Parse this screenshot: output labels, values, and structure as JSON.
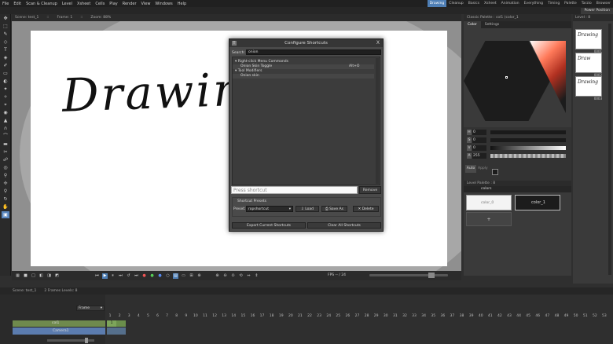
{
  "menubar": {
    "items": [
      "File",
      "Edit",
      "Scan & Cleanup",
      "Level",
      "Xsheet",
      "Cells",
      "Play",
      "Render",
      "View",
      "Windows",
      "Help"
    ]
  },
  "rooms": {
    "items": [
      "Drawing",
      "Cleanup",
      "Basics",
      "Xsheet",
      "Animation",
      "Everything",
      "Timing",
      "Palette",
      "Tarzio",
      "Browser"
    ],
    "active": "Drawing",
    "power": "Power Position"
  },
  "viewer": {
    "header": [
      "Scene: test_1",
      "::",
      "Frame: 1",
      "::",
      "Zoom: 88%"
    ],
    "drawing_text": "Drawing",
    "fps": "FPS -- / 24"
  },
  "dialog": {
    "title": "Configure Shortcuts",
    "close": "X",
    "search_label": "Search:",
    "search_value": "onion",
    "tree": {
      "cat1": "Right-click Menu Commands",
      "item1": "Onion Skin Toggle",
      "item1_shortcut": "Alt+O",
      "cat2": "Tool Modifiers",
      "item2": "Onion skin"
    },
    "press_placeholder": "Press shortcut",
    "remove": "Remove",
    "presets_title": "Shortcut Presets",
    "preset_label": "Preset:",
    "preset_value": "ropshortcut",
    "load": "Load",
    "save_as": "Save As",
    "delete": "Delete",
    "export": "Export Current Shortcuts",
    "clear": "Clear All Shortcuts"
  },
  "color_panel": {
    "header": "Classic Palette : col1 (color_1",
    "tabs": [
      "Color",
      "Settings"
    ],
    "active_tab": "Color",
    "sliders": [
      {
        "label": "H",
        "value": "0"
      },
      {
        "label": "S",
        "value": "0"
      },
      {
        "label": "V",
        "value": "0"
      },
      {
        "label": "A",
        "value": "255"
      }
    ],
    "auto": "Auto",
    "apply": "Apply"
  },
  "level_strip_panel": {
    "header": "Level Palette : 8",
    "palette_name": "colors",
    "cell1": "color_0",
    "cell2": "color_1",
    "add": "+"
  },
  "level_strip": {
    "header": "Level : 8",
    "frames": [
      {
        "text": "Drawing",
        "num": "0001"
      },
      {
        "text": "Draw",
        "num": "0002"
      },
      {
        "text": "Drawing",
        "num": "0003"
      }
    ]
  },
  "xsheet": {
    "header": [
      "Scene: test_1",
      "2 Frames  Levels: 8"
    ],
    "frame_dropdown": "Frame",
    "col1": "col1",
    "col2": "Camera1",
    "cell1": "1",
    "frame_numbers": [
      "1",
      "2",
      "3",
      "4",
      "5",
      "6",
      "7",
      "8",
      "9",
      "10",
      "11",
      "12",
      "13",
      "14",
      "15",
      "16",
      "17",
      "18",
      "19",
      "20",
      "21",
      "22",
      "23",
      "24",
      "25",
      "26",
      "27",
      "28",
      "29",
      "30",
      "31",
      "32",
      "33",
      "34",
      "35",
      "36",
      "37",
      "38",
      "39",
      "40",
      "41",
      "42",
      "43",
      "44",
      "45",
      "46",
      "47",
      "48",
      "49",
      "50",
      "51",
      "52",
      "53"
    ]
  },
  "colors": {
    "accent": "#4f7fb5",
    "panel": "#3a3a3a",
    "paper": "#ffffff",
    "column_green": "#6f8a4d",
    "column_blue": "#5b7caf"
  }
}
